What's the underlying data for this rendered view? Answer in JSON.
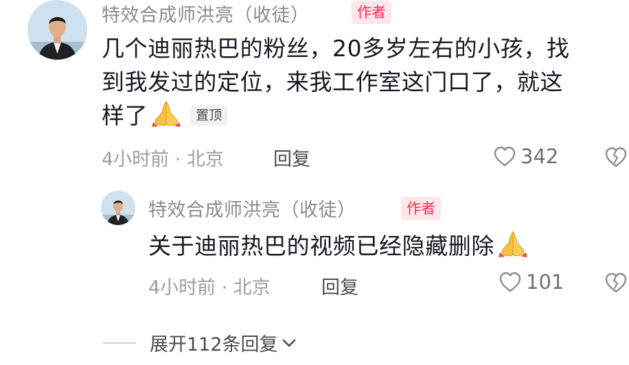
{
  "comment": {
    "author": "特效合成师洪亮（收徒）",
    "author_badge": "作者",
    "text_line1": "几个迪丽热巴的粉丝，20多岁左右的小孩，找",
    "text_line2": "到我发过的定位，来我工作室这门口了，就这",
    "text_line3": "样了",
    "emoji": "folded-hands-icon",
    "pinned_label": "置顶",
    "time_location": "4小时前 · 北京",
    "reply_label": "回复",
    "like_count": "342"
  },
  "reply": {
    "author": "特效合成师洪亮（收徒）",
    "author_badge": "作者",
    "text": "关于迪丽热巴的视频已经隐藏删除",
    "emoji": "folded-hands-icon",
    "time_location": "4小时前 · 北京",
    "reply_label": "回复",
    "like_count": "101"
  },
  "expand_replies": {
    "label": "展开112条回复"
  },
  "colors": {
    "badge_text": "#fe2c55",
    "badge_bg": "#fde7ea",
    "secondary_text": "#8a8b91"
  }
}
